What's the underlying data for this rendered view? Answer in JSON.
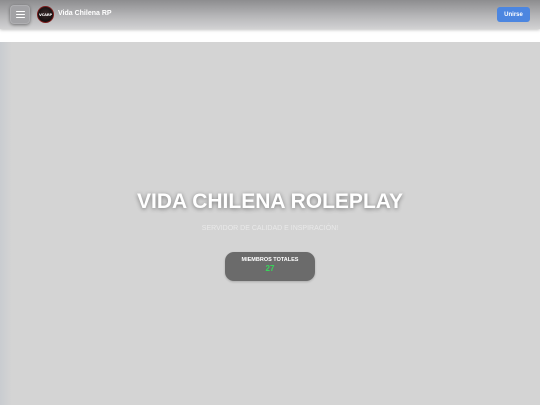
{
  "navbar": {
    "brand": "Vida Chilena RP",
    "logo_text": "VCARP",
    "join_label": "Unirse",
    "menu_icon": "hamburger-icon"
  },
  "hero": {
    "title": "VIDA CHILENA ROLEPLAY",
    "subtitle": "SERVIDOR DE CALIDAD E INSPIRACIÓN!",
    "members": {
      "label": "MIEMBROS TOTALES",
      "count": "27"
    }
  },
  "colors": {
    "accent": "#4c86e0",
    "count_green": "#37d65a",
    "hero_bg": "#d4d4d4",
    "card_bg": "#6b6b6b"
  }
}
